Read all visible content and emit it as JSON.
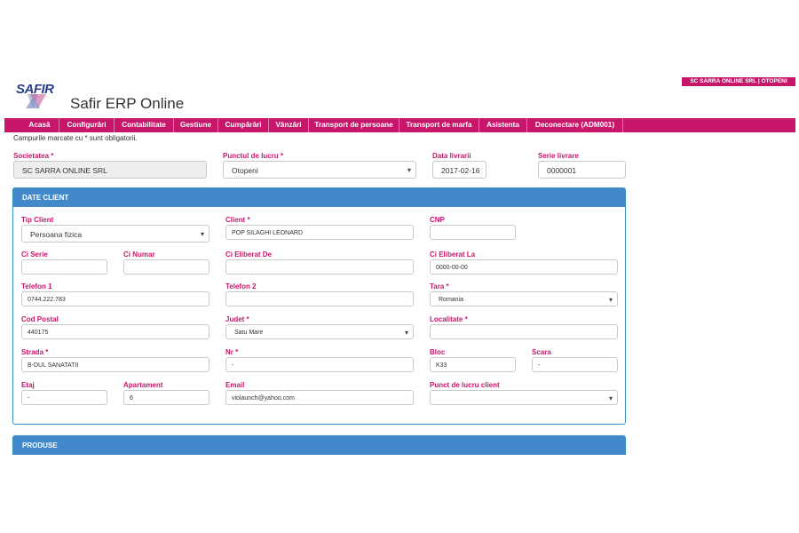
{
  "header": {
    "company_badge": "SC SARRA ONLINE SRL | OTOPENI",
    "logo_text": "SAFIR",
    "app_title": "Safir ERP Online"
  },
  "nav": {
    "items": [
      "Acasă",
      "Configurări",
      "Contabilitate",
      "Gestiune",
      "Cumpărări",
      "Vânzări",
      "Transport de persoane",
      "Transport de marfa",
      "Asistenta",
      "Deconectare (ADM001)"
    ]
  },
  "form": {
    "required_note": "Campurile marcate cu * sunt obligatorii.",
    "top": {
      "societatea": {
        "label": "Societatea *",
        "value": "SC SARRA ONLINE SRL"
      },
      "punct_lucru": {
        "label": "Punctul de lucru *",
        "value": "Otopeni"
      },
      "data_livrarii": {
        "label": "Data livrarii",
        "value": "2017-02-16"
      },
      "serie_livrare": {
        "label": "Serie livrare",
        "value": "0000001"
      }
    },
    "client_panel": {
      "title": "DATE CLIENT",
      "tip_client": {
        "label": "Tip Client",
        "value": "Persoana fizica"
      },
      "client": {
        "label": "Client *",
        "value": "POP SILAGHI LEONARD"
      },
      "cnp": {
        "label": "CNP",
        "value": ""
      },
      "ci_serie": {
        "label": "Ci Serie",
        "value": ""
      },
      "ci_numar": {
        "label": "Ci Numar",
        "value": ""
      },
      "ci_eliberat_de": {
        "label": "Ci Eliberat De",
        "value": ""
      },
      "ci_eliberat_la": {
        "label": "Ci Eliberat La",
        "value": "0000-00-00"
      },
      "telefon1": {
        "label": "Telefon 1",
        "value": "0744.222.783"
      },
      "telefon2": {
        "label": "Telefon 2",
        "value": ""
      },
      "tara": {
        "label": "Tara *",
        "value": "Romania"
      },
      "cod_postal": {
        "label": "Cod Postal",
        "value": "440175"
      },
      "judet": {
        "label": "Judet *",
        "value": "Satu Mare"
      },
      "localitate": {
        "label": "Localitate *",
        "value": ""
      },
      "strada": {
        "label": "Strada *",
        "value": "B-DUL SANATATII"
      },
      "nr": {
        "label": "Nr *",
        "value": "-"
      },
      "bloc": {
        "label": "Bloc",
        "value": "K33"
      },
      "scara": {
        "label": "Scara",
        "value": "-"
      },
      "etaj": {
        "label": "Etaj",
        "value": "-"
      },
      "apartament": {
        "label": "Apartament",
        "value": "6"
      },
      "email": {
        "label": "Email",
        "value": "violaunch@yahoo.com"
      },
      "punct_livrare": {
        "label": "Punct de lucru client",
        "value": ""
      }
    },
    "products_panel": {
      "title": "PRODUSE"
    }
  },
  "colors": {
    "brand": "#c8166b",
    "panel_header": "#4289cb"
  }
}
